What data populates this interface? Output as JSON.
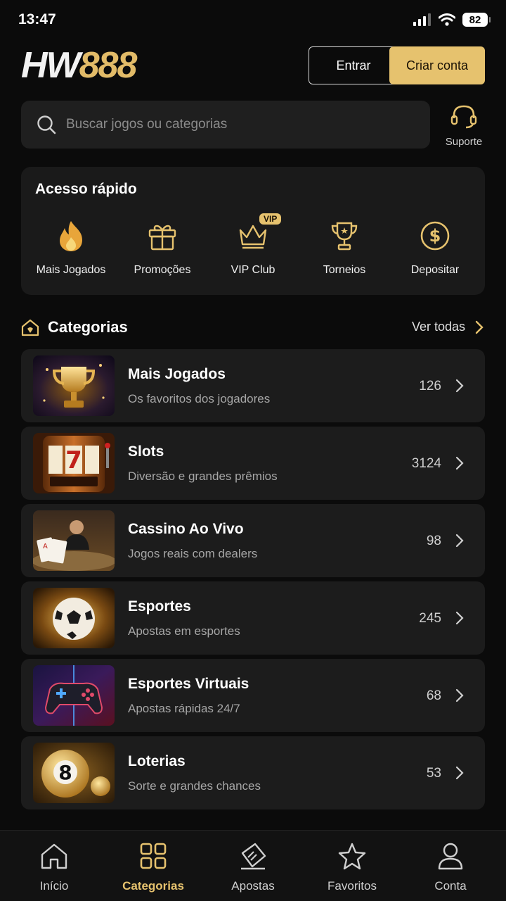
{
  "status": {
    "time": "13:47",
    "battery": "82"
  },
  "header": {
    "logo_a": "HW",
    "logo_b": "888",
    "login_label": "Entrar",
    "signup_label": "Criar conta"
  },
  "search": {
    "placeholder": "Buscar jogos ou categorias"
  },
  "support": {
    "label": "Suporte"
  },
  "quick_access": {
    "title": "Acesso rápido",
    "items": [
      {
        "label": "Mais Jogados",
        "icon": "flame-icon"
      },
      {
        "label": "Promoções",
        "icon": "gift-icon"
      },
      {
        "label": "VIP Club",
        "icon": "crown-icon",
        "badge": "VIP"
      },
      {
        "label": "Torneios",
        "icon": "trophy-icon"
      },
      {
        "label": "Depositar",
        "icon": "dollar-coin-icon"
      }
    ]
  },
  "categories": {
    "title": "Categorias",
    "see_all": "Ver todas",
    "items": [
      {
        "name": "Mais Jogados",
        "desc": "Os favoritos dos jogadores",
        "count": "126",
        "thumb": "trophy"
      },
      {
        "name": "Slots",
        "desc": "Diversão e grandes prêmios",
        "count": "3124",
        "thumb": "slot-machine"
      },
      {
        "name": "Cassino Ao Vivo",
        "desc": "Jogos reais com dealers",
        "count": "98",
        "thumb": "live-dealer"
      },
      {
        "name": "Esportes",
        "desc": "Apostas em esportes",
        "count": "245",
        "thumb": "soccer-ball"
      },
      {
        "name": "Esportes Virtuais",
        "desc": "Apostas rápidas 24/7",
        "count": "68",
        "thumb": "gamepad"
      },
      {
        "name": "Loterias",
        "desc": "Sorte e grandes chances",
        "count": "53",
        "thumb": "eight-ball"
      }
    ]
  },
  "bottom_nav": {
    "active": "Categorias",
    "items": [
      {
        "label": "Início",
        "icon": "home-icon"
      },
      {
        "label": "Categorias",
        "icon": "grid-icon"
      },
      {
        "label": "Apostas",
        "icon": "ticket-icon"
      },
      {
        "label": "Favoritos",
        "icon": "star-icon"
      },
      {
        "label": "Conta",
        "icon": "user-icon"
      }
    ]
  },
  "colors": {
    "accent": "#e6c26e",
    "background": "#0b0b0b",
    "card": "#1c1c1c"
  }
}
